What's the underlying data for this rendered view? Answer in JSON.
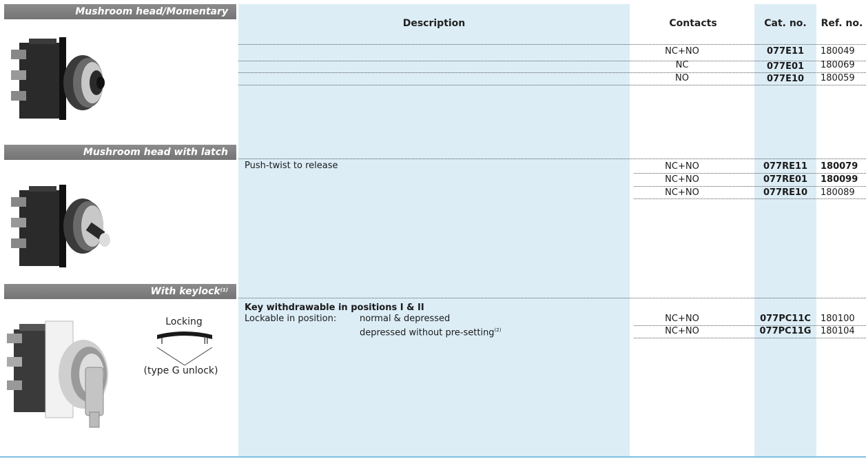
{
  "columns": {
    "description": "Description",
    "contacts": "Contacts",
    "cat_no": "Cat. no.",
    "ref_no": "Ref. no."
  },
  "sections": [
    {
      "title": "Mushroom head/Momentary",
      "rows": [
        {
          "contacts": "NC+NO",
          "cat": "077E11",
          "ref": "180049"
        },
        {
          "contacts": "NC",
          "cat": "077E01",
          "ref": "180069"
        },
        {
          "contacts": "NO",
          "cat": "077E10",
          "ref": "180059"
        }
      ]
    },
    {
      "title": "Mushroom head with latch",
      "description": "Push-twist to release",
      "rows": [
        {
          "contacts": "NC+NO",
          "cat": "077RE11",
          "ref": "180079"
        },
        {
          "contacts": "NC+NO",
          "cat": "077RE01",
          "ref": "180099"
        },
        {
          "contacts": "NC+NO",
          "cat": "077RE10",
          "ref": "180089"
        }
      ]
    },
    {
      "title": "With keylock",
      "title_sup": "(1)",
      "desc_bold": "Key withdrawable in positions I & II",
      "desc_line2_label": "Lockable in position:",
      "desc_line2_value": "normal & depressed",
      "desc_line3": "depressed without pre-setting",
      "desc_line3_sup": "(2)",
      "lock_diagram": {
        "label": "Locking",
        "pos_left": "I",
        "pos_right": "II",
        "note": "(type G unlock)"
      },
      "rows": [
        {
          "contacts": "NC+NO",
          "cat": "077PC11C",
          "ref": "180100"
        },
        {
          "contacts": "NC+NO",
          "cat": "077PC11G",
          "ref": "180104"
        }
      ]
    }
  ]
}
